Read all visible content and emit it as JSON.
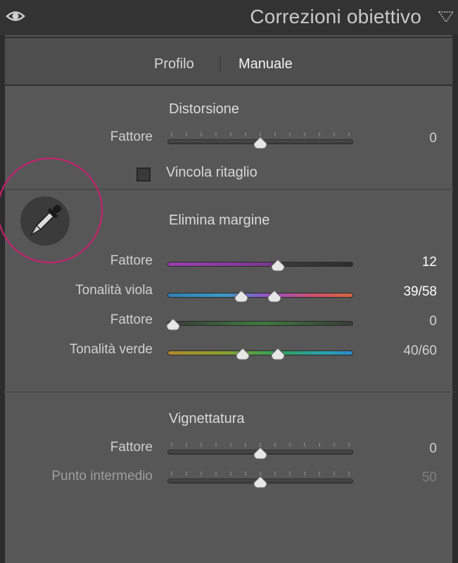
{
  "header": {
    "title": "Correzioni obiettivo",
    "eye_icon": "eye-icon",
    "menu_icon": "triangle-down-icon"
  },
  "tabs": {
    "profile": "Profilo",
    "manual": "Manuale",
    "active": "Manuale"
  },
  "colors": {
    "panel": "#575757",
    "header": "#333333",
    "highlight_ring": "#cc1e72"
  },
  "distortion": {
    "title": "Distorsione",
    "factor": {
      "label": "Fattore",
      "value": "0",
      "level": 0.5
    },
    "constrain_crop": {
      "label": "Vincola ritaglio",
      "checked": false
    }
  },
  "eyedropper": {
    "icon": "eyedropper-icon"
  },
  "fringe": {
    "title": "Elimina margine",
    "purple_amount": {
      "label": "Fattore",
      "value": "12",
      "level": 0.6
    },
    "purple_hue": {
      "label": "Tonalità viola",
      "value": "39/58",
      "range": [
        0.39,
        0.58
      ]
    },
    "green_amount": {
      "label": "Fattore",
      "value": "0",
      "level": 0.0
    },
    "green_hue": {
      "label": "Tonalità verde",
      "value": "40/60",
      "range": [
        0.4,
        0.6
      ]
    }
  },
  "vignette": {
    "title": "Vignettatura",
    "amount": {
      "label": "Fattore",
      "value": "0",
      "level": 0.5
    },
    "midpoint": {
      "label": "Punto intermedio",
      "value": "50",
      "level": 0.5
    }
  }
}
